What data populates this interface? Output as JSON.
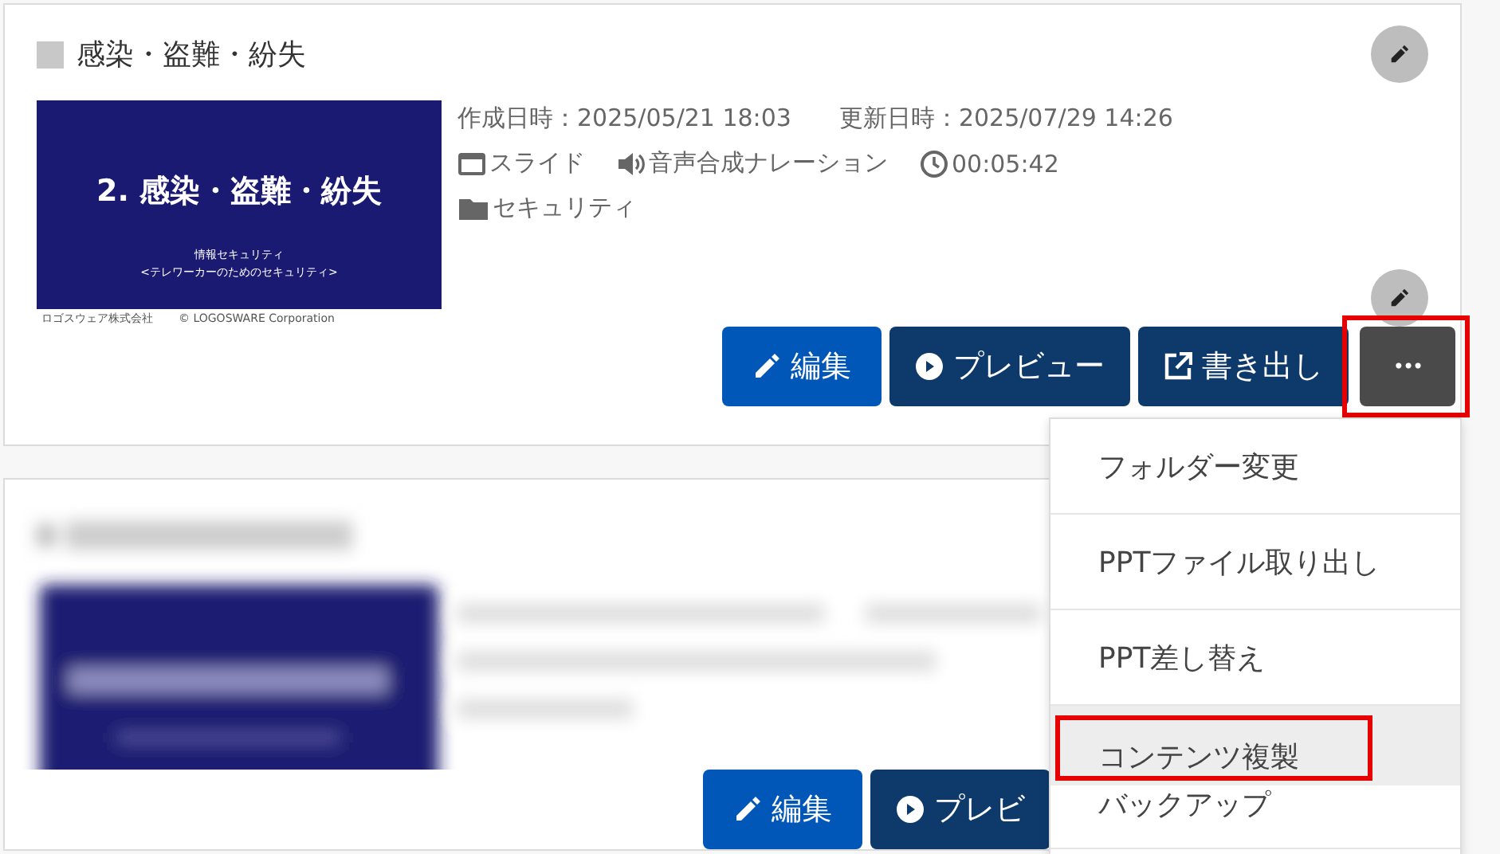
{
  "cards": [
    {
      "title": "感染・盗難・紛失",
      "kind": "full",
      "checked": false,
      "slide": {
        "heading": "2. 感染・盗難・紛失",
        "subtitle": "情報セキュリティ",
        "subtitle_2": "<テレワーカーのためのセキュリティ>",
        "footer_left": "ロゴスウェア株式会社",
        "footer_center": "© LOGOSWARE Corporation"
      },
      "created": "作成日時：2025/05/21 18:03",
      "updated": "更新日時：2025/07/29 14:26",
      "meta": [
        {
          "kind": "slide",
          "text": "スライド"
        },
        {
          "kind": "audio",
          "text": "音声合成ナレーション"
        },
        {
          "kind": "clock",
          "text": "00:05:42"
        }
      ],
      "folder": "セキュリティ",
      "actions": [
        {
          "kind": "edit",
          "label": "編集",
          "highlighted": false
        },
        {
          "kind": "preview",
          "label": "プレビュー",
          "highlighted": false
        },
        {
          "kind": "export",
          "label": "書き出し",
          "highlighted": false
        },
        {
          "kind": "more",
          "label": "•••",
          "highlighted": true
        }
      ]
    },
    {
      "kind": "blurred",
      "actions": [
        {
          "kind": "edit",
          "label": "編集"
        },
        {
          "kind": "preview",
          "label": "プレビ"
        }
      ]
    }
  ],
  "menu": {
    "items": [
      {
        "label": "フォルダー変更",
        "selected": false,
        "highlighted": false
      },
      {
        "label": "PPTファイル取り出し",
        "selected": false,
        "highlighted": false
      },
      {
        "label": "PPT差し替え",
        "selected": false,
        "highlighted": false
      },
      {
        "label": "コンテンツ複製",
        "selected": true,
        "highlighted": true
      },
      {
        "label": "バックアップ",
        "selected": false,
        "highlighted": false
      }
    ]
  }
}
